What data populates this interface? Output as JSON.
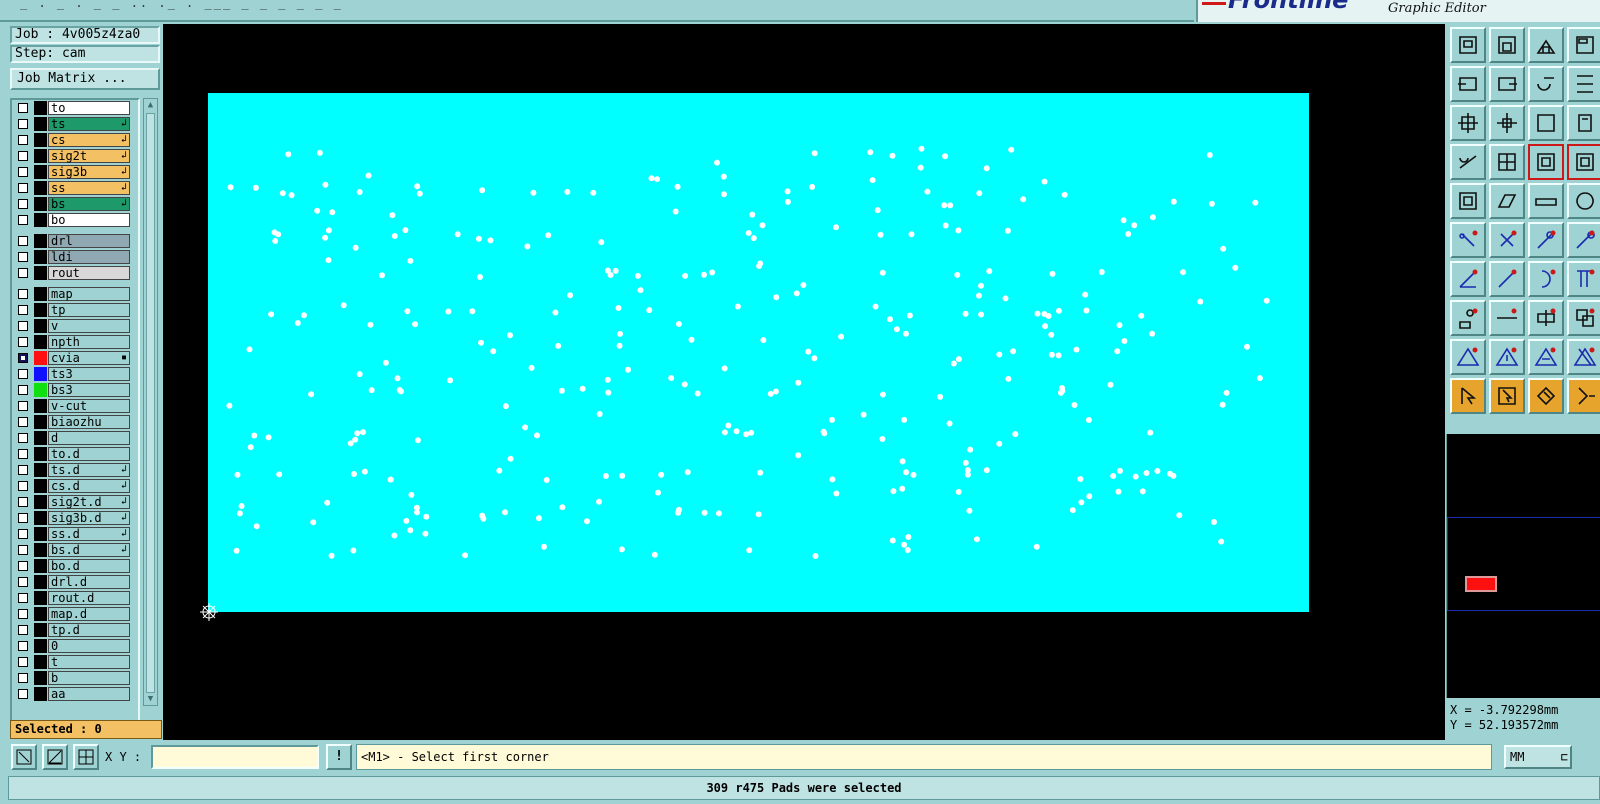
{
  "top": {
    "cut_text": "_  .   _   . _ _ ..   ._ . ___ _ _  _ _ _ _",
    "logo_text": "Frontline",
    "logo_subtitle": "Graphic Editor"
  },
  "job": {
    "job_label": "Job : 4v005z4za0",
    "step_label": "Step: cam",
    "matrix_button": "Job Matrix ..."
  },
  "layers": [
    {
      "name": "to",
      "bg": "#ffffff",
      "mark": "",
      "swatch": "#000000",
      "checked": false,
      "sep": false
    },
    {
      "name": "ts",
      "bg": "#1e9a6a",
      "mark": "↲",
      "swatch": "#000000",
      "checked": false,
      "sep": false
    },
    {
      "name": "cs",
      "bg": "#f3c063",
      "mark": "↲",
      "swatch": "#000000",
      "checked": false,
      "sep": false
    },
    {
      "name": "sig2t",
      "bg": "#f3c063",
      "mark": "↲",
      "swatch": "#000000",
      "checked": false,
      "sep": false
    },
    {
      "name": "sig3b",
      "bg": "#f3c063",
      "mark": "↲",
      "swatch": "#000000",
      "checked": false,
      "sep": false
    },
    {
      "name": "ss",
      "bg": "#f3c063",
      "mark": "↲",
      "swatch": "#000000",
      "checked": false,
      "sep": false
    },
    {
      "name": "bs",
      "bg": "#1e9a6a",
      "mark": "↲",
      "swatch": "#000000",
      "checked": false,
      "sep": false
    },
    {
      "name": "bo",
      "bg": "#ffffff",
      "mark": "",
      "swatch": "#000000",
      "checked": false,
      "sep": true
    },
    {
      "name": "drl",
      "bg": "#8fa8b2",
      "mark": "",
      "swatch": "#000000",
      "checked": false,
      "sep": false
    },
    {
      "name": "ldi",
      "bg": "#8fa8b2",
      "mark": "",
      "swatch": "#000000",
      "checked": false,
      "sep": false
    },
    {
      "name": "rout",
      "bg": "#d8d8d8",
      "mark": "",
      "swatch": "#000000",
      "checked": false,
      "sep": true
    },
    {
      "name": "map",
      "bg": "#9fd2d2",
      "mark": "",
      "swatch": "#000000",
      "checked": false,
      "sep": false
    },
    {
      "name": "tp",
      "bg": "#9fd2d2",
      "mark": "",
      "swatch": "#000000",
      "checked": false,
      "sep": false
    },
    {
      "name": "v",
      "bg": "#9fd2d2",
      "mark": "",
      "swatch": "#000000",
      "checked": false,
      "sep": false
    },
    {
      "name": "npth",
      "bg": "#9fd2d2",
      "mark": "",
      "swatch": "#000000",
      "checked": false,
      "sep": false
    },
    {
      "name": "cvia",
      "bg": "#9fd2d2",
      "mark": "▪",
      "swatch": "#ff1010",
      "checked": true,
      "sep": false
    },
    {
      "name": "ts3",
      "bg": "#9fd2d2",
      "mark": "",
      "swatch": "#1010ff",
      "checked": false,
      "sep": false
    },
    {
      "name": "bs3",
      "bg": "#9fd2d2",
      "mark": "",
      "swatch": "#10e010",
      "checked": false,
      "sep": false
    },
    {
      "name": "v-cut",
      "bg": "#9fd2d2",
      "mark": "",
      "swatch": "#000000",
      "checked": false,
      "sep": false
    },
    {
      "name": "biaozhu",
      "bg": "#9fd2d2",
      "mark": "",
      "swatch": "#000000",
      "checked": false,
      "sep": false
    },
    {
      "name": "d",
      "bg": "#9fd2d2",
      "mark": "",
      "swatch": "#000000",
      "checked": false,
      "sep": false
    },
    {
      "name": "to.d",
      "bg": "#9fd2d2",
      "mark": "",
      "swatch": "#000000",
      "checked": false,
      "sep": false
    },
    {
      "name": "ts.d",
      "bg": "#9fd2d2",
      "mark": "↲",
      "swatch": "#000000",
      "checked": false,
      "sep": false
    },
    {
      "name": "cs.d",
      "bg": "#9fd2d2",
      "mark": "↲",
      "swatch": "#000000",
      "checked": false,
      "sep": false
    },
    {
      "name": "sig2t.d",
      "bg": "#9fd2d2",
      "mark": "↲",
      "swatch": "#000000",
      "checked": false,
      "sep": false
    },
    {
      "name": "sig3b.d",
      "bg": "#9fd2d2",
      "mark": "↲",
      "swatch": "#000000",
      "checked": false,
      "sep": false
    },
    {
      "name": "ss.d",
      "bg": "#9fd2d2",
      "mark": "↲",
      "swatch": "#000000",
      "checked": false,
      "sep": false
    },
    {
      "name": "bs.d",
      "bg": "#9fd2d2",
      "mark": "↲",
      "swatch": "#000000",
      "checked": false,
      "sep": false
    },
    {
      "name": "bo.d",
      "bg": "#9fd2d2",
      "mark": "",
      "swatch": "#000000",
      "checked": false,
      "sep": false
    },
    {
      "name": "drl.d",
      "bg": "#9fd2d2",
      "mark": "",
      "swatch": "#000000",
      "checked": false,
      "sep": false
    },
    {
      "name": "rout.d",
      "bg": "#9fd2d2",
      "mark": "",
      "swatch": "#000000",
      "checked": false,
      "sep": false
    },
    {
      "name": "map.d",
      "bg": "#9fd2d2",
      "mark": "",
      "swatch": "#000000",
      "checked": false,
      "sep": false
    },
    {
      "name": "tp.d",
      "bg": "#9fd2d2",
      "mark": "",
      "swatch": "#000000",
      "checked": false,
      "sep": false
    },
    {
      "name": "0",
      "bg": "#9fd2d2",
      "mark": "",
      "swatch": "#000000",
      "checked": false,
      "sep": false
    },
    {
      "name": "t",
      "bg": "#9fd2d2",
      "mark": "",
      "swatch": "#000000",
      "checked": false,
      "sep": false
    },
    {
      "name": "b",
      "bg": "#9fd2d2",
      "mark": "",
      "swatch": "#000000",
      "checked": false,
      "sep": false
    },
    {
      "name": "aa",
      "bg": "#9fd2d2",
      "mark": "",
      "swatch": "#000000",
      "checked": false,
      "sep": false
    }
  ],
  "selection": {
    "selected_label": "Selected : 0"
  },
  "canvas": {
    "background": "#000000",
    "board_color": "#00ffff",
    "pad_color": "#ffffff",
    "pad_count": 309
  },
  "toolbar": {
    "tools": [
      "open-job-icon",
      "save-icon",
      "home-icon",
      "layer-icon",
      "import-icon",
      "export-icon",
      "swap-icon",
      "route-icon",
      "zoom-fit-icon",
      "zoom-center-icon",
      "scale-1-2-icon",
      "help-icon",
      "snap-icon",
      "grid-icon",
      "drc-icon",
      "drc-alt-icon",
      "square-pad-icon",
      "polygon-icon",
      "ruler-icon",
      "round-pad-icon",
      "connect-icon",
      "delete-node-icon",
      "move-node-icon",
      "add-node-icon",
      "line-icon",
      "line-alt-icon",
      "arc-icon",
      "text-icon",
      "copy-icon",
      "cut-line-icon",
      "measure-icon",
      "group-icon",
      "triangle-icon",
      "triangle-a-icon",
      "triangle-b-icon",
      "triangle-c-icon",
      "select-pointer-icon",
      "select-box-icon",
      "select-poly-icon",
      "select-net-icon"
    ],
    "colors": [
      "#9fd2d2",
      "#e6a42c",
      "#cc1818"
    ]
  },
  "coords": {
    "x_label": "X = -3.792298mm",
    "y_label": "Y = 52.193572mm"
  },
  "command": {
    "xy_label": "X Y :",
    "xy_value": "",
    "exclaim": "!",
    "prompt": "<M1> - Select first corner",
    "units": "MM"
  },
  "status": {
    "message": "309 r475 Pads were selected"
  }
}
